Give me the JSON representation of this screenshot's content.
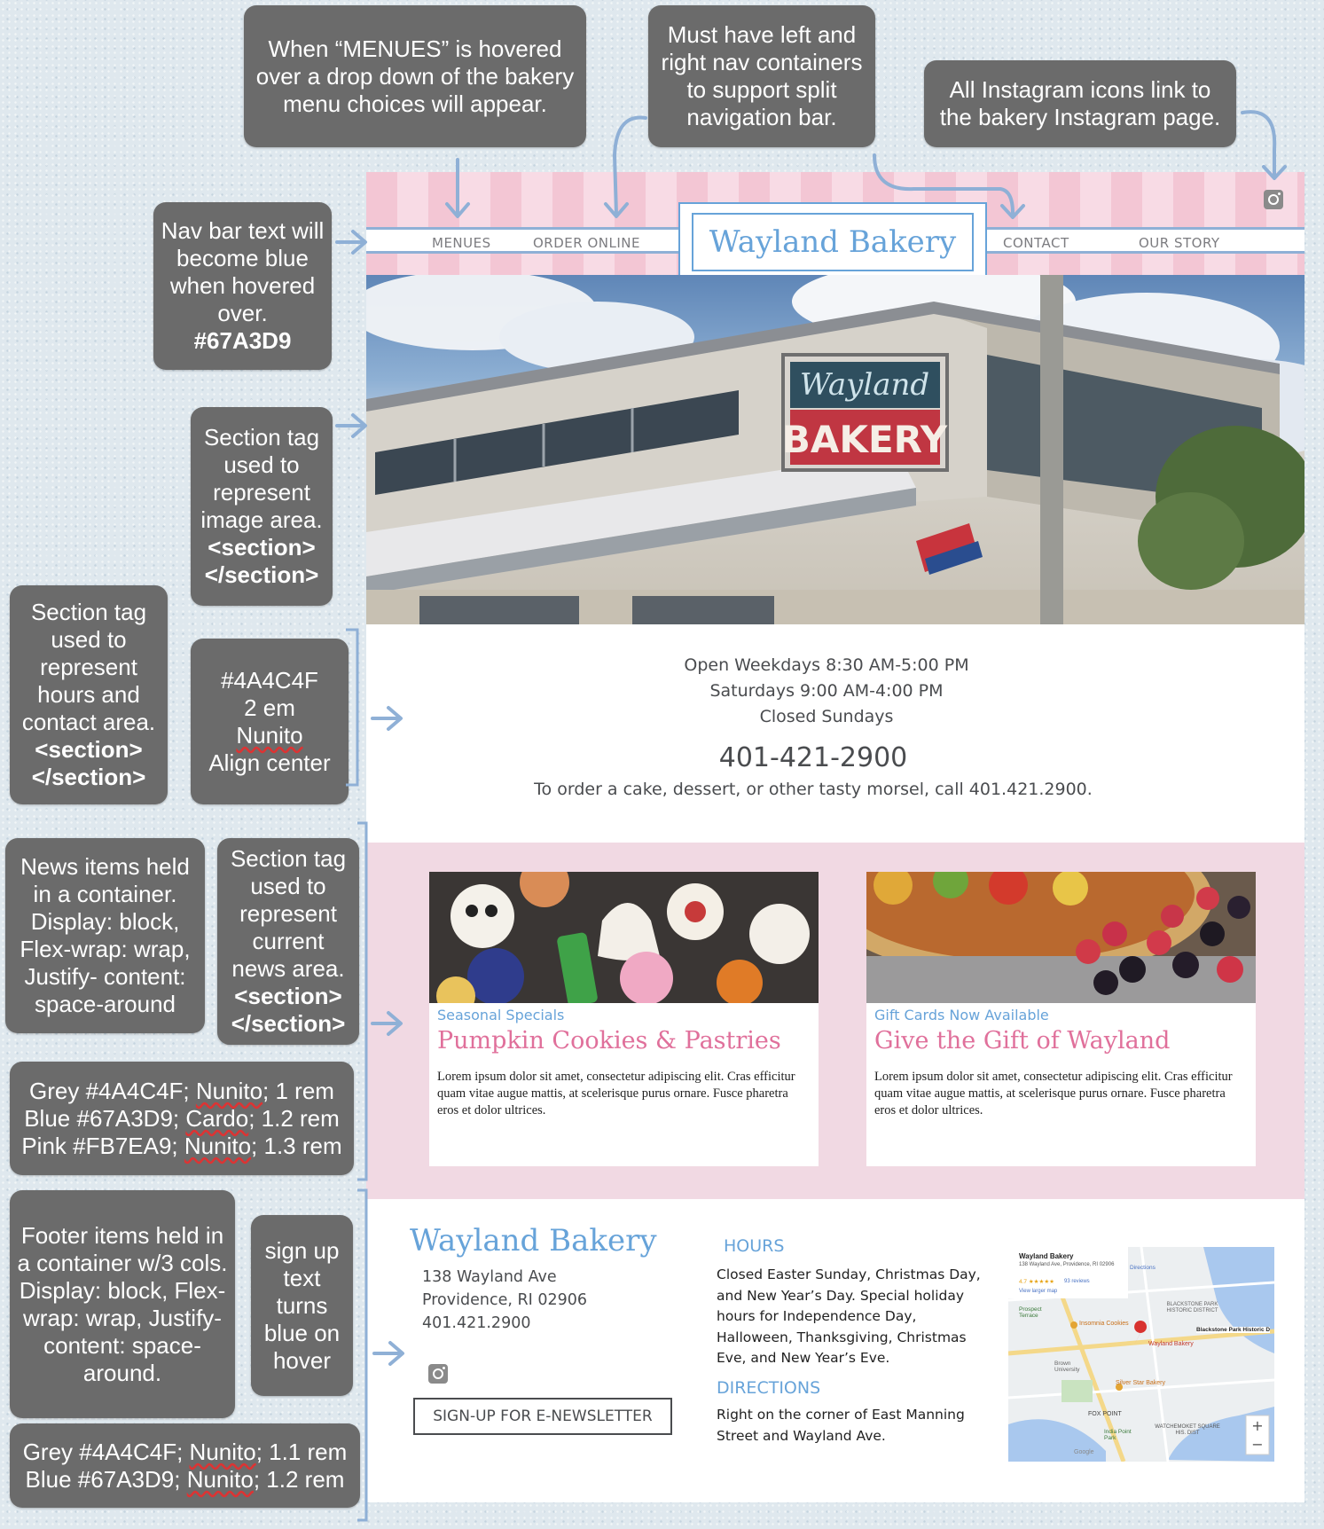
{
  "notes": {
    "menues_hover": "When “MENUES” is hovered over a drop down of the bakery menu choices will appear.",
    "split_nav": "Must have left and right nav containers to support split navigation bar.",
    "instagram": "All Instagram icons link to the bakery Instagram page.",
    "nav_blue_text": "Nav bar text will become blue when hovered over.",
    "nav_blue_color": "#67A3D9",
    "image_section_text": "Section tag used to represent image area.",
    "image_section_tag": "<section></section>",
    "hours_section_text": "Section tag used to represent hours and contact area.",
    "hours_section_tag": "<section></section>",
    "hours_style": [
      "#4A4C4F",
      "2 em",
      "Nunito",
      "Align center"
    ],
    "news_container": "News items held in a container. Display: block, Flex-wrap: wrap, Justify- content: space-around",
    "news_section_text": "Section tag used to represent current news area.",
    "news_section_tag": "<section></section>",
    "news_style": [
      "Grey #4A4C4F; ",
      "Nunito",
      "; 1 rem",
      "Blue #67A3D9; ",
      "Cardo",
      "; 1.2 rem",
      "Pink #FB7EA9; ",
      "Nunito",
      "; 1.3 rem"
    ],
    "footer_container": "Footer items held in a container w/3 cols. Display: block, Flex-wrap: wrap, Justify- content: space-around.",
    "signup_hover": "sign up text turns blue on hover",
    "footer_style": [
      "Grey #4A4C4F; ",
      "Nunito",
      "; 1.1 rem",
      "Blue #67A3D9; ",
      "Nunito",
      "; 1.2 rem"
    ]
  },
  "site": {
    "nav_left": [
      "MENUES",
      "ORDER ONLINE"
    ],
    "logo": "Wayland Bakery",
    "nav_right": [
      "CONTACT",
      "OUR STORY"
    ],
    "hero_sign_script": "Wayland",
    "hero_sign_main": "BAKERY",
    "hours": [
      "Open Weekdays 8:30 AM-5:00 PM",
      "Saturdays 9:00 AM-4:00 PM",
      "Closed Sundays"
    ],
    "phone": "401-421-2900",
    "order_text": "To order a cake, dessert, or other tasty morsel, call 401.421.2900.",
    "news": [
      {
        "kicker": "Seasonal Specials",
        "headline": "Pumpkin Cookies & Pastries",
        "body": "Lorem ipsum dolor sit amet, consectetur adipiscing elit. Cras efficitur quam vitae augue mattis, at scelerisque purus ornare. Fusce pharetra eros et dolor ultrices."
      },
      {
        "kicker": "Gift Cards Now Available",
        "headline": "Give the Gift of Wayland",
        "body": "Lorem ipsum dolor sit amet, consectetur adipiscing elit. Cras efficitur quam vitae augue mattis, at scelerisque purus ornare. Fusce pharetra eros et dolor ultrices."
      }
    ],
    "footer": {
      "logo": "Wayland Bakery",
      "address": [
        "138 Wayland Ave",
        "Providence, RI 02906",
        "401.421.2900"
      ],
      "signup": "SIGN-UP FOR E-NEWSLETTER",
      "hours_heading": "HOURS",
      "hours_text": "Closed Easter Sunday, Christmas Day, and New Year’s Day. Special holiday hours for Independence Day, Halloween, Thanksgiving, Christmas Eve, and New Year’s Eve.",
      "directions_heading": "DIRECTIONS",
      "directions_text": "Right on the corner of East Manning Street and Wayland Ave."
    },
    "map": {
      "place": "Wayland Bakery",
      "address": "138 Wayland Ave, Providence, RI 02906",
      "rating": "4.7 ★★★★★",
      "reviews": "93 reviews",
      "larger": "View larger map",
      "directions": "Directions",
      "labels": {
        "insomnia": "Insomnia Cookies",
        "pin": "Wayland Bakery",
        "blackstone": "BLACKSTONE PARK HISTORIC DISTRICT",
        "blackstone_park": "Blackstone Park Historic D",
        "silver_star": "Silver Star Bakery",
        "fox_point": "FOX POINT",
        "brown": "Brown University",
        "watchemoket": "WATCHEMOKET SQUARE HIS. DIST",
        "india_point": "India Point Park",
        "prospect": "Prospect Terrace",
        "google": "Google"
      }
    }
  },
  "colors": {
    "grey": "#4A4C4F",
    "blue": "#67A3D9",
    "pink": "#FB7EA9",
    "annotation": "#6b6b6b",
    "arrow": "#8fb0d6"
  }
}
